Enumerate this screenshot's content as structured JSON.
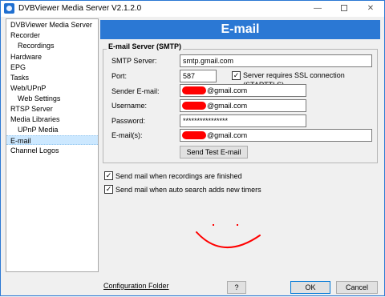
{
  "window": {
    "title": "DVBViewer Media Server V2.1.2.0",
    "minimize_glyph": "—",
    "close_glyph": "✕"
  },
  "nav": {
    "items": [
      {
        "label": "DVBViewer Media Server",
        "level": 0,
        "selected": false
      },
      {
        "label": "Recorder",
        "level": 0,
        "selected": false
      },
      {
        "label": "Recordings",
        "level": 1,
        "selected": false
      },
      {
        "label": "Hardware",
        "level": 0,
        "selected": false
      },
      {
        "label": "EPG",
        "level": 0,
        "selected": false
      },
      {
        "label": "Tasks",
        "level": 0,
        "selected": false
      },
      {
        "label": "Web/UPnP",
        "level": 0,
        "selected": false
      },
      {
        "label": "Web Settings",
        "level": 1,
        "selected": false
      },
      {
        "label": "RTSP Server",
        "level": 0,
        "selected": false
      },
      {
        "label": "Media Libraries",
        "level": 0,
        "selected": false
      },
      {
        "label": "UPnP Media",
        "level": 1,
        "selected": false
      },
      {
        "label": "E-mail",
        "level": 0,
        "selected": true
      },
      {
        "label": "Channel Logos",
        "level": 0,
        "selected": false
      }
    ]
  },
  "panel": {
    "header": "E-mail",
    "group_title": "E-mail Server (SMTP)",
    "smtp_server_label": "SMTP Server:",
    "smtp_server_value": "smtp.gmail.com",
    "port_label": "Port:",
    "port_value": "587",
    "ssl_label": "Server requires SSL connection (STARTTLS)",
    "ssl_checked": true,
    "sender_label": "Sender E-mail:",
    "sender_value": "@gmail.com",
    "username_label": "Username:",
    "username_value": "@gmail.com",
    "password_label": "Password:",
    "password_value": "****************",
    "emails_label": "E-mail(s):",
    "emails_value": "@gmail.com",
    "test_button": "Send Test E-mail",
    "opt_recordings_label": "Send mail when recordings are finished",
    "opt_recordings_checked": true,
    "opt_autosearch_label": "Send mail when auto search adds new timers",
    "opt_autosearch_checked": true
  },
  "footer": {
    "config_link": "Configuration Folder",
    "help_button": "?",
    "ok_button": "OK",
    "cancel_button": "Cancel"
  },
  "colors": {
    "accent": "#2b78d4",
    "selection": "#cce8ff",
    "redaction": "#ff0000"
  }
}
